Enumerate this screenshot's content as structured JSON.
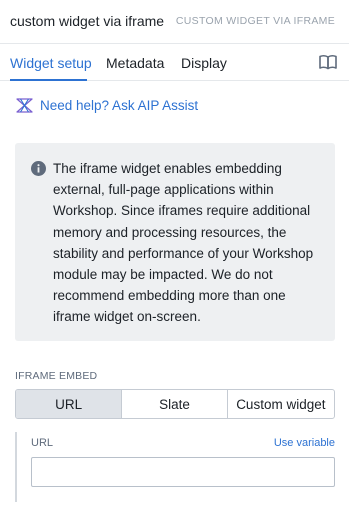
{
  "header": {
    "widget_name": "custom widget via iframe",
    "widget_type": "CUSTOM WIDGET VIA IFRAME"
  },
  "tabs": [
    {
      "label": "Widget setup",
      "active": true
    },
    {
      "label": "Metadata",
      "active": false
    },
    {
      "label": "Display",
      "active": false
    }
  ],
  "docs_icon": "book-icon",
  "help": {
    "label": "Need help? Ask AIP Assist",
    "icon": "aip-assist-icon"
  },
  "callout": {
    "icon": "info-icon",
    "lines": [
      "The iframe widget enables embedding",
      "external, full-page applications within",
      "Workshop. Since iframes require additional",
      "memory and processing resources, the",
      "stability and performance of your Workshop",
      "module may be impacted. We do not",
      "recommend embedding more than one",
      "iframe widget on-screen."
    ]
  },
  "iframe_embed": {
    "label": "IFRAME EMBED",
    "options": [
      "URL",
      "Slate",
      "Custom widget"
    ],
    "selected": "URL"
  },
  "url_field": {
    "label": "URL",
    "use_variable": "Use variable",
    "value": "",
    "placeholder": ""
  },
  "colors": {
    "accent": "#2d72d2",
    "callout_bg": "#eef0f2",
    "selected_segment": "#dfe3e8"
  }
}
